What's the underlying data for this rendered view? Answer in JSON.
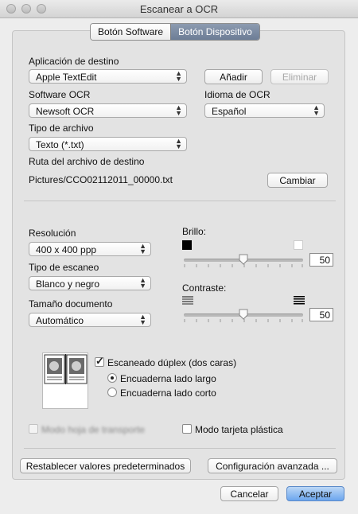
{
  "window": {
    "title": "Escanear a OCR"
  },
  "tabs": [
    {
      "label": "Botón Software"
    },
    {
      "label": "Botón Dispositivo"
    }
  ],
  "destination_app": {
    "label": "Aplicación de destino",
    "value": "Apple TextEdit",
    "add_label": "Añadir",
    "remove_label": "Eliminar"
  },
  "ocr_software": {
    "label": "Software OCR",
    "value": "Newsoft OCR"
  },
  "ocr_language": {
    "label": "Idioma de OCR",
    "value": "Español"
  },
  "file_type": {
    "label": "Tipo de archivo",
    "value": "Texto (*.txt)"
  },
  "dest_path": {
    "label": "Ruta del archivo de destino",
    "value": "Pictures/CCO02112011_00000.txt",
    "change_label": "Cambiar"
  },
  "resolution": {
    "label": "Resolución",
    "value": "400 x 400 ppp"
  },
  "scan_type": {
    "label": "Tipo de escaneo",
    "value": "Blanco y negro"
  },
  "document_size": {
    "label": "Tamaño documento",
    "value": "Automático"
  },
  "brightness": {
    "label": "Brillo:",
    "value": "50",
    "level": 0.5
  },
  "contrast": {
    "label": "Contraste:",
    "value": "50",
    "level": 0.5
  },
  "duplex": {
    "label": "Escaneado dúplex (dos caras)",
    "checked": true,
    "options": [
      {
        "label": "Encuaderna lado largo",
        "selected": true
      },
      {
        "label": "Encuaderna lado corto",
        "selected": false
      }
    ]
  },
  "carrier_sheet": {
    "label": "Modo hoja de transporte",
    "enabled": false
  },
  "plastic_card": {
    "label": "Modo tarjeta plástica",
    "checked": false
  },
  "restore_defaults": {
    "label": "Restablecer valores predeterminados"
  },
  "advanced": {
    "label": "Configuración avanzada ..."
  },
  "footer": {
    "cancel_label": "Cancelar",
    "accept_label": "Aceptar"
  }
}
